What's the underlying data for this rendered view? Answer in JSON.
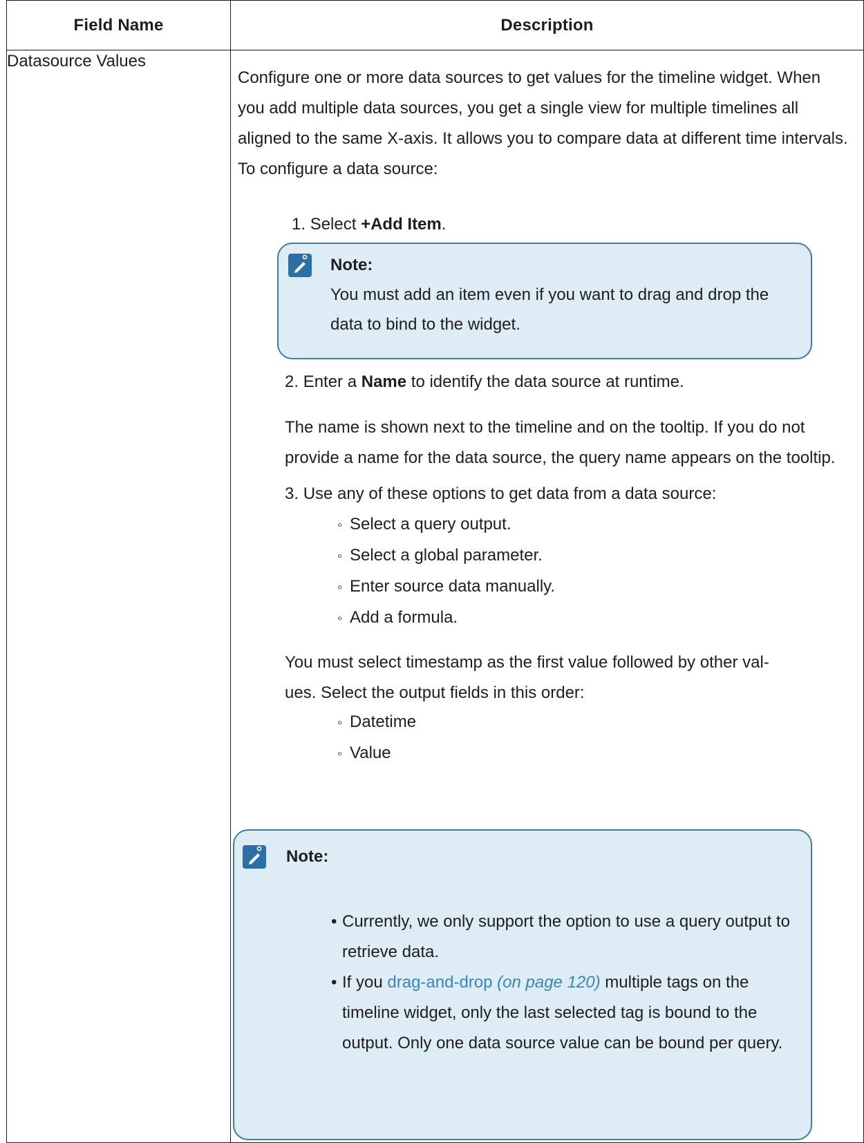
{
  "table": {
    "header": {
      "field_name": "Field Name",
      "description": "Description"
    },
    "row": {
      "field_name": "Datasource Values",
      "intro": "Configure one or more data sources to get values for the timeline widget. When you add multiple data sources, you get a single view for multiple timelines all aligned to the same X-axis. It allows you to compare data at different time intervals. To configure a data source:",
      "step1": {
        "number": "1.",
        "pre": "Select ",
        "bold": "+Add Item",
        "post": ".",
        "note": {
          "title": "Note:",
          "text": "You must add an item even if you want to drag and drop the data to bind to the widget."
        }
      },
      "step2": {
        "number": "2.",
        "pre": "Enter a ",
        "bold": "Name",
        "post": " to identify the data source at runtime.",
        "para": "The name is shown next to the timeline and on the tooltip. If you do not provide a name for the data source, the query name appears on the tooltip."
      },
      "step3": {
        "number": "3.",
        "text": "Use any of these options to get data from a data source:",
        "options": [
          "Select a query output.",
          "Select a global parameter.",
          "Enter source data manually.",
          "Add a formula."
        ],
        "para_line1": "You must select timestamp as the first value followed by other val-",
        "para_line2": "ues. Select the output fields in this order:",
        "fields": [
          "Datetime",
          "Value"
        ]
      },
      "note2": {
        "title": "Note:",
        "bullet1": "Currently, we only support the option to use a query output to retrieve data.",
        "bullet2_pre": "If you ",
        "bullet2_link": "drag-and-drop",
        "bullet2_ref": "(on page 120)",
        "bullet2_post": " multiple tags on the timeline widget, only the last selected tag is bound to the output. Only one data source value can be bound per query."
      }
    }
  },
  "colors": {
    "note_border": "#3f7ba2",
    "note_background": "#deecf6",
    "note_icon": "#2a6fa5",
    "link": "#3b85b8"
  }
}
